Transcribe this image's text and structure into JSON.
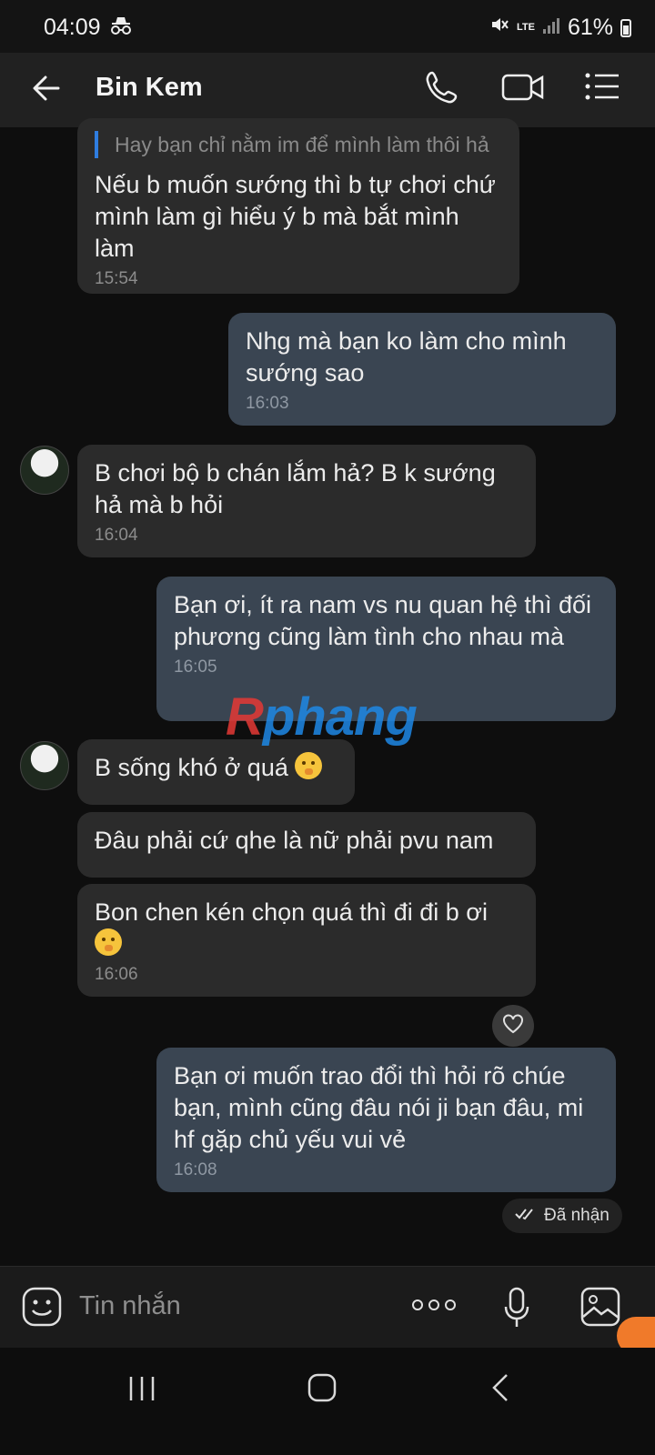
{
  "status_bar": {
    "time": "04:09",
    "network": "LTE",
    "battery": "61%"
  },
  "header": {
    "contact_name": "Bin Kem"
  },
  "messages": [
    {
      "quote": "Hay bạn chỉ nằm im để mình làm thôi hả",
      "text": "Nếu b muốn sướng thì b tự chơi chứ mình làm gì hiểu ý b mà bắt mình làm",
      "time": "15:54"
    },
    {
      "text": "Nhg mà bạn ko làm cho mình sướng sao",
      "time": "16:03"
    },
    {
      "text": "B chơi bộ b chán lắm hả? B k sướng hả mà b hỏi",
      "time": "16:04"
    },
    {
      "text": "Bạn ơi, ít ra nam vs nu quan hệ thì đối phương cũng làm tình cho nhau mà",
      "time": "16:05"
    },
    {
      "text": "B sống khó ở quá"
    },
    {
      "text": "Đâu phải cứ qhe là nữ phải pvu nam"
    },
    {
      "text": "Bon chen kén chọn quá thì đi đi b ơi",
      "time": "16:06"
    },
    {
      "text": "Bạn ơi muốn trao đổi thì hỏi rõ chúe bạn, mình cũng đâu nói ji bạn đâu, mi hf gặp chủ yếu vui vẻ",
      "time": "16:08"
    }
  ],
  "receipt": "Đã nhận",
  "watermark": {
    "r": "R",
    "rest": "phang"
  },
  "composer": {
    "placeholder": "Tin nhắn"
  }
}
